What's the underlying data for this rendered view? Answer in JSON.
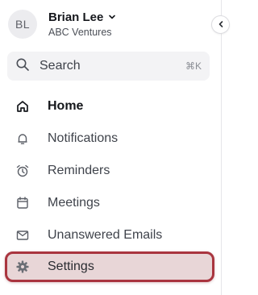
{
  "user": {
    "initials": "BL",
    "name": "Brian Lee",
    "company": "ABC Ventures"
  },
  "search": {
    "placeholder": "Search",
    "shortcut": "⌘K"
  },
  "nav": {
    "items": [
      {
        "label": "Home",
        "icon": "home-icon",
        "active": true
      },
      {
        "label": "Notifications",
        "icon": "bell-icon"
      },
      {
        "label": "Reminders",
        "icon": "alarm-clock-icon"
      },
      {
        "label": "Meetings",
        "icon": "calendar-icon"
      },
      {
        "label": "Unanswered Emails",
        "icon": "mail-icon"
      },
      {
        "label": "Settings",
        "icon": "gear-icon",
        "highlighted": true
      }
    ]
  },
  "colors": {
    "highlight_border": "#a9353f",
    "highlight_fill": "#e8d6d7"
  }
}
